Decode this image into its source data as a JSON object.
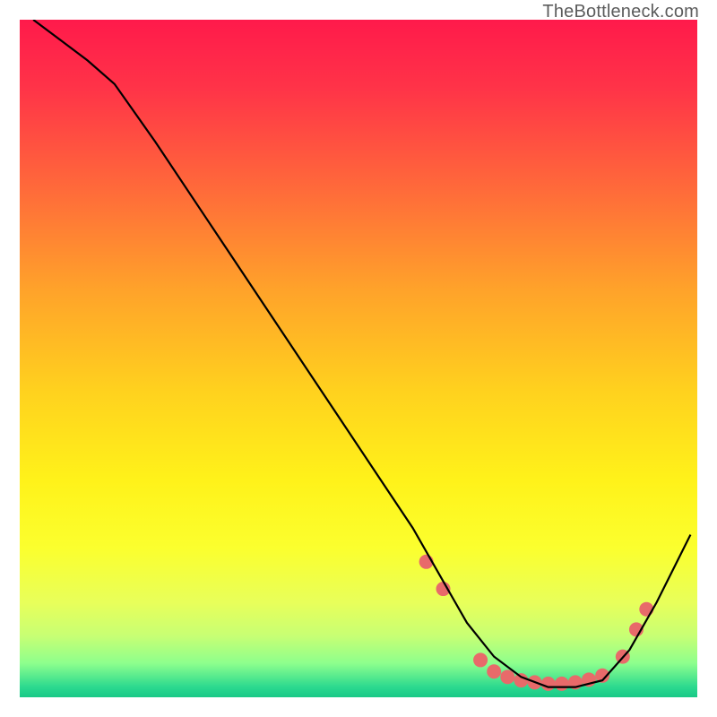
{
  "attribution": "TheBottleneck.com",
  "chart_data": {
    "type": "line",
    "title": "",
    "xlabel": "",
    "ylabel": "",
    "xlim": [
      0,
      100
    ],
    "ylim": [
      0,
      100
    ],
    "gradient_stops": [
      {
        "pos": 0.0,
        "color": "#ff1a4b"
      },
      {
        "pos": 0.1,
        "color": "#ff3348"
      },
      {
        "pos": 0.25,
        "color": "#ff6a3a"
      },
      {
        "pos": 0.4,
        "color": "#ffa32a"
      },
      {
        "pos": 0.55,
        "color": "#ffd21e"
      },
      {
        "pos": 0.68,
        "color": "#fff21a"
      },
      {
        "pos": 0.78,
        "color": "#fbff2e"
      },
      {
        "pos": 0.86,
        "color": "#e8ff5a"
      },
      {
        "pos": 0.91,
        "color": "#c7ff74"
      },
      {
        "pos": 0.95,
        "color": "#8dff8d"
      },
      {
        "pos": 0.985,
        "color": "#2bd98f"
      },
      {
        "pos": 1.0,
        "color": "#19c987"
      }
    ],
    "series": [
      {
        "name": "bottleneck-curve",
        "x": [
          2,
          6,
          10,
          14,
          20,
          28,
          36,
          44,
          52,
          58,
          62,
          66,
          70,
          74,
          78,
          82,
          86,
          90,
          94,
          99
        ],
        "y": [
          100,
          97,
          94,
          90.5,
          82,
          70,
          58,
          46,
          34,
          25,
          18,
          11,
          6,
          3,
          1.5,
          1.5,
          2.5,
          7,
          14,
          24
        ]
      }
    ],
    "markers": {
      "name": "highlight-dots",
      "color": "#e86a6a",
      "radius": 8,
      "points": [
        {
          "x": 60,
          "y": 20
        },
        {
          "x": 62.5,
          "y": 16
        },
        {
          "x": 68,
          "y": 5.5
        },
        {
          "x": 70,
          "y": 3.8
        },
        {
          "x": 72,
          "y": 3.0
        },
        {
          "x": 74,
          "y": 2.5
        },
        {
          "x": 76,
          "y": 2.2
        },
        {
          "x": 78,
          "y": 2.0
        },
        {
          "x": 80,
          "y": 2.0
        },
        {
          "x": 82,
          "y": 2.2
        },
        {
          "x": 84,
          "y": 2.6
        },
        {
          "x": 86,
          "y": 3.2
        },
        {
          "x": 89,
          "y": 6
        },
        {
          "x": 91,
          "y": 10
        },
        {
          "x": 92.5,
          "y": 13
        }
      ]
    }
  }
}
